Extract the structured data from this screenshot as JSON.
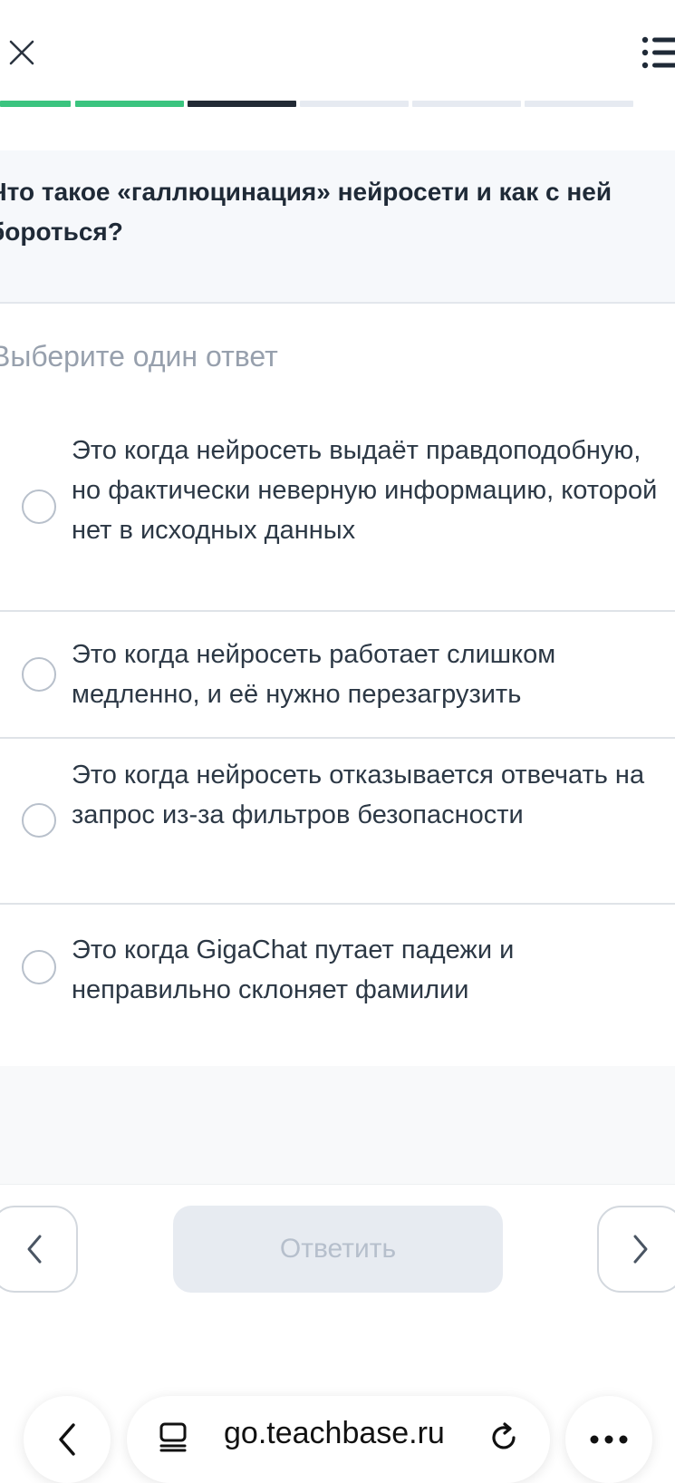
{
  "header": {
    "close_icon": "close-icon",
    "menu_icon": "list-menu-icon"
  },
  "progress": {
    "segments": [
      {
        "state": "completed",
        "color": "#3bc47f"
      },
      {
        "state": "completed",
        "color": "#3bc47f"
      },
      {
        "state": "current",
        "color": "#222a35"
      },
      {
        "state": "pending",
        "color": "#e6eaf1"
      },
      {
        "state": "pending",
        "color": "#e6eaf1"
      },
      {
        "state": "pending",
        "color": "#e6eaf1"
      }
    ]
  },
  "question": {
    "text": "Что такое «галлюцинация» нейросети и как с ней бороться?",
    "instruction": "Выберите один ответ"
  },
  "options": [
    {
      "label": "Это когда нейросеть выдаёт правдоподобную, но фактически неверную информацию, которой нет в исходных данных",
      "selected": false
    },
    {
      "label": "Это когда нейросеть работает слишком медленно, и её нужно перезагрузить",
      "selected": false
    },
    {
      "label": "Это когда нейросеть отказывается отвечать на запрос из-за фильтров безопасности",
      "selected": false
    },
    {
      "label": "Это когда GigaChat путает падежи и неправильно склоняет фамилии",
      "selected": false
    }
  ],
  "navigation": {
    "prev_icon": "chevron-left-icon",
    "next_icon": "chevron-right-icon",
    "answer_label": "Ответить",
    "answer_enabled": false
  },
  "browser": {
    "url": "go.teachbase.ru",
    "back_icon": "chevron-left-icon",
    "reader_icon": "reader-icon",
    "reload_icon": "reload-icon",
    "more_icon": "more-icon"
  },
  "colors": {
    "accent_green": "#3bc47f",
    "dark": "#222a35",
    "muted": "#97a0ad"
  }
}
